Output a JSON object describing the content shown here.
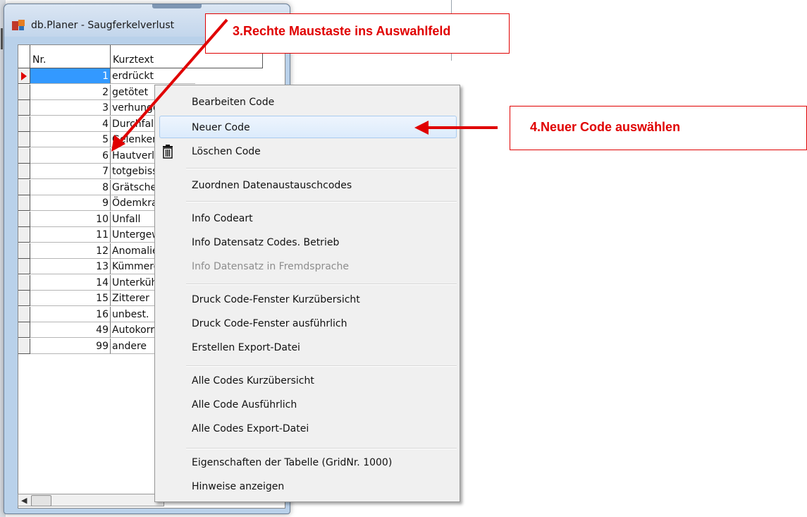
{
  "window": {
    "title": "db.Planer - Saugferkelverlust"
  },
  "grid": {
    "headers": {
      "nr": "Nr.",
      "text": "Kurztext"
    },
    "rows": [
      {
        "nr": "1",
        "text": "erdrückt"
      },
      {
        "nr": "2",
        "text": "getötet"
      },
      {
        "nr": "3",
        "text": "verhungert"
      },
      {
        "nr": "4",
        "text": "Durchfall"
      },
      {
        "nr": "5",
        "text": "Gelenkentzündung"
      },
      {
        "nr": "6",
        "text": "Hautverletzung"
      },
      {
        "nr": "7",
        "text": "totgebissen"
      },
      {
        "nr": "8",
        "text": "Grätscher"
      },
      {
        "nr": "9",
        "text": "Ödemkrankheit"
      },
      {
        "nr": "10",
        "text": "Unfall"
      },
      {
        "nr": "11",
        "text": "Untergewicht"
      },
      {
        "nr": "12",
        "text": "Anomalie"
      },
      {
        "nr": "13",
        "text": "Kümmerer"
      },
      {
        "nr": "14",
        "text": "Unterkühlung"
      },
      {
        "nr": "15",
        "text": "Zitterer"
      },
      {
        "nr": "16",
        "text": "unbest."
      },
      {
        "nr": "49",
        "text": "Autokorrektur"
      },
      {
        "nr": "99",
        "text": "andere"
      }
    ],
    "selected_row": 0
  },
  "context_menu": {
    "items": [
      "Bearbeiten Code",
      "Neuer Code",
      "Löschen Code",
      "Zuordnen Datenaustauschcodes",
      "Info Codeart",
      "Info Datensatz Codes. Betrieb",
      "Info Datensatz in Fremdsprache",
      "Druck Code-Fenster Kurzübersicht",
      "Druck Code-Fenster ausführlich",
      "Erstellen Export-Datei",
      "Alle Codes Kurzübersicht",
      "Alle Code  Ausführlich",
      "Alle Codes Export-Datei",
      "Eigenschaften der Tabelle (GridNr. 1000)",
      "Hinweise anzeigen"
    ],
    "highlighted": "Neuer Code",
    "disabled": [
      "Info Datensatz in Fremdsprache"
    ],
    "icon_for_delete": "trash-icon"
  },
  "callouts": {
    "step3": "3.Rechte Maustaste ins Auswahlfeld",
    "step4": "4.Neuer Code auswählen"
  },
  "colors": {
    "annotation": "#e00000",
    "selection": "#3399ff"
  }
}
